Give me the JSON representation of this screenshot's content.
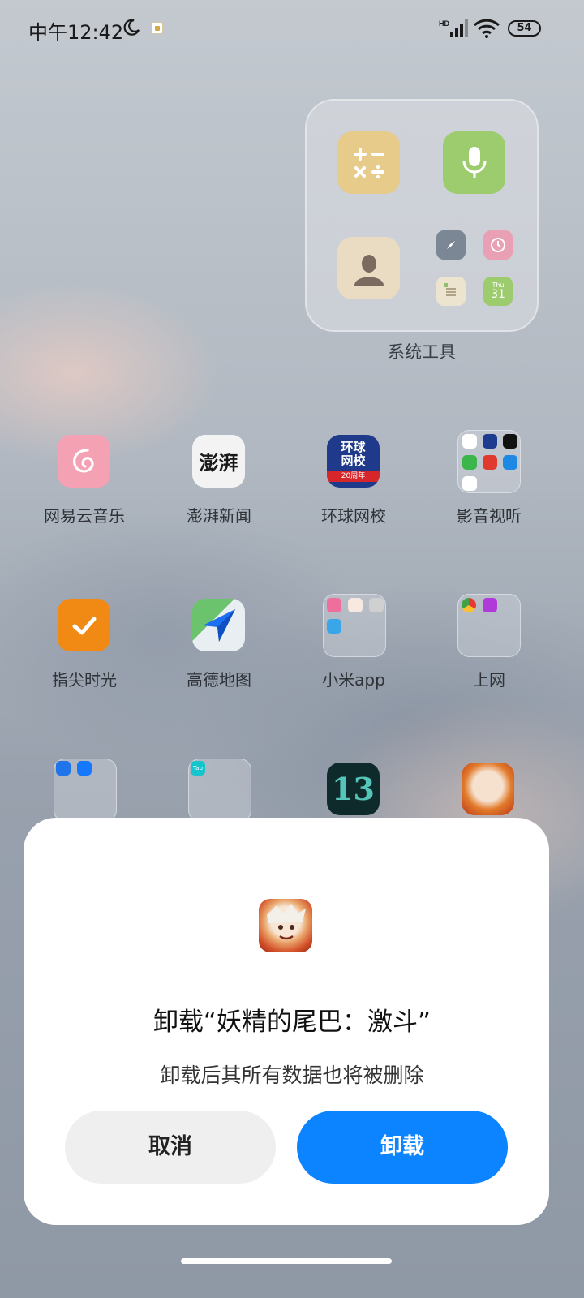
{
  "status_bar": {
    "time": "中午12:42",
    "network_label": "HD",
    "battery": "54"
  },
  "folder_system": {
    "label": "系统工具",
    "apps": [
      "calculator-icon",
      "recorder-icon",
      "contacts-icon",
      "compass-icon",
      "clock-icon",
      "notes-icon",
      "calendar-icon"
    ],
    "calendar_day": "Thu",
    "calendar_date": "31"
  },
  "row1": [
    {
      "label": "网易云音乐"
    },
    {
      "label": "澎湃新闻",
      "icon_text": "澎湃"
    },
    {
      "label": "环球网校",
      "icon_text_top": "环球",
      "icon_text_mid": "网校",
      "icon_text_badge": "20周年"
    },
    {
      "label": "影音视听"
    }
  ],
  "row2": [
    {
      "label": "指尖时光"
    },
    {
      "label": "高德地图"
    },
    {
      "label": "小米app"
    },
    {
      "label": "上网"
    }
  ],
  "row3_folder_text": "Tap",
  "dialog": {
    "title": "卸载“妖精的尾巴：激斗”",
    "message": "卸载后其所有数据也将被删除",
    "cancel": "取消",
    "confirm": "卸载"
  },
  "colors": {
    "confirm_button": "#0d84ff",
    "cancel_button": "#efefef"
  }
}
